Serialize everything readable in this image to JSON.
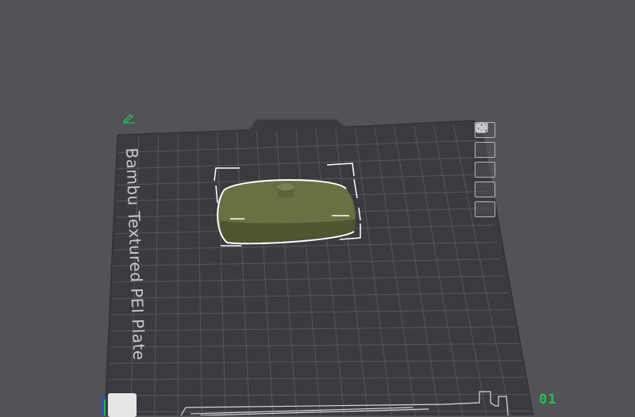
{
  "plate": {
    "label": "Bambu Textured PEI Plate",
    "index": "01"
  },
  "tools": [
    {
      "name": "close-icon"
    },
    {
      "name": "arrange-icon"
    },
    {
      "name": "layout-icon"
    },
    {
      "name": "lock-icon"
    },
    {
      "name": "settings-icon"
    }
  ],
  "model": {
    "color": "#6b7043",
    "shade": "#4f5431"
  },
  "colors": {
    "background": "#525258",
    "plate": "#3a3a3f",
    "grid": "#55555b",
    "accent": "#22c055"
  }
}
